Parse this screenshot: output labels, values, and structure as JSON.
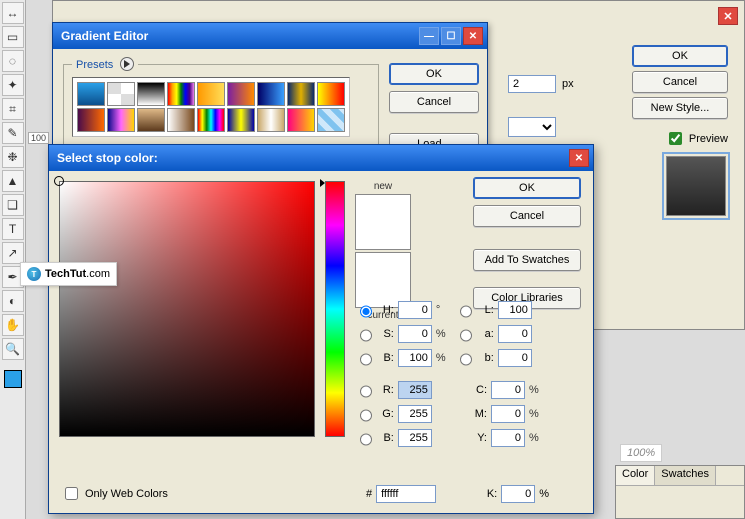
{
  "colors": {
    "accent": "#2a64c0",
    "close_red": "#e04a3f"
  },
  "toolbox": {
    "swatch_fg": "#2aa0e8"
  },
  "ruler_mark": "100",
  "bgdialog": {
    "buttons": {
      "ok": "OK",
      "cancel": "Cancel",
      "newstyle": "New Style..."
    },
    "preview_label": "Preview",
    "preview_checked": true,
    "size_value": "2",
    "size_unit": "px"
  },
  "gradient_editor": {
    "title": "Gradient Editor",
    "presets_legend": "Presets",
    "buttons": {
      "ok": "OK",
      "cancel": "Cancel",
      "load": "Load..."
    },
    "presets": [
      "linear-gradient(180deg,#2aa0e8,#0b4f8c)",
      "repeating-conic-gradient(#fff 0 25%, #ddd 0 50%)",
      "linear-gradient(180deg,#000,#fff)",
      "linear-gradient(90deg,red,orange,yellow,green,blue,indigo,violet)",
      "linear-gradient(90deg,#f90,#ffde59)",
      "linear-gradient(90deg,#7b1fa2,#ff8a00)",
      "linear-gradient(90deg,#006,#3aa0ff)",
      "linear-gradient(90deg,#0b2a6b,#e0b000,#0b2a6b)",
      "linear-gradient(90deg,#ff0,#f00)",
      "linear-gradient(90deg,#4a0b4a,#ff6a00)",
      "linear-gradient(90deg,#0a0a8a,#ff66ff,#ffd400)",
      "linear-gradient(180deg,#deb887,#5c3a1d)",
      "linear-gradient(90deg,#fff,#7a4a1d)",
      "linear-gradient(90deg,red,yellow,green,cyan,blue,magenta,red)",
      "linear-gradient(90deg,#00a,#ff0,#00a)",
      "linear-gradient(90deg,#c9a86a,#fff,#c9a86a)",
      "linear-gradient(90deg,#ff0080,#ffd400)",
      "repeating-linear-gradient(45deg,#7fc3ef 0 6px,#cfe8fa 6px 12px)"
    ]
  },
  "color_picker": {
    "title": "Select stop color:",
    "labels": {
      "new": "new",
      "current": "current"
    },
    "buttons": {
      "ok": "OK",
      "cancel": "Cancel",
      "add_swatch": "Add To Swatches",
      "libraries": "Color Libraries"
    },
    "hsb": {
      "H": "0",
      "S": "0",
      "B": "100"
    },
    "lab": {
      "L": "100",
      "a": "0",
      "b": "0"
    },
    "rgb": {
      "R": "255",
      "G": "255",
      "B": "255"
    },
    "cmyk": {
      "C": "0",
      "M": "0",
      "Y": "0",
      "K": "0"
    },
    "units": {
      "deg": "°",
      "pct": "%"
    },
    "only_web_label": "Only Web Colors",
    "only_web_checked": false,
    "hex_prefix": "#",
    "hex": "ffffff"
  },
  "palette_panel": {
    "zoom": "100%",
    "tabs": {
      "color": "Color",
      "swatches": "Swatches"
    }
  },
  "watermark": {
    "text": "TechTut",
    "suffix": ".com",
    "glyph": "T"
  }
}
